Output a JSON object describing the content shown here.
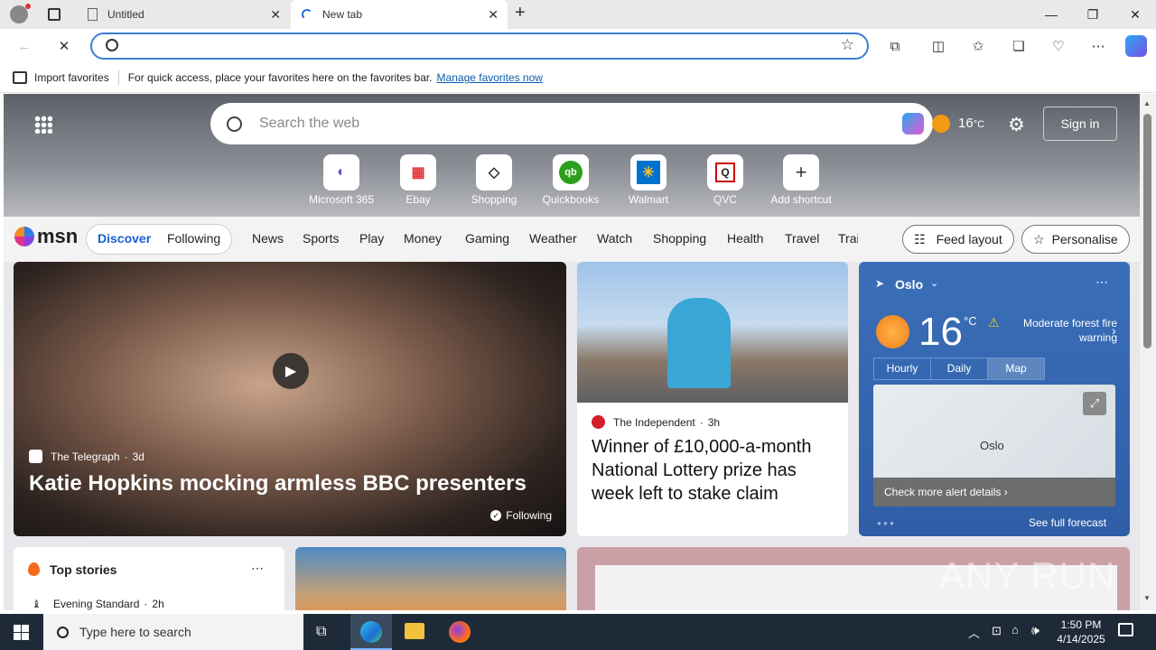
{
  "browser": {
    "tabs": [
      {
        "title": "Untitled"
      },
      {
        "title": "New tab"
      }
    ],
    "minimize": "—",
    "restore": "❐",
    "close": "✕",
    "add_tab": "+"
  },
  "favbar": {
    "import_label": "Import favorites",
    "hint": "For quick access, place your favorites here on the favorites bar.",
    "manage_link": "Manage favorites now"
  },
  "msn": {
    "search_placeholder": "Search the web",
    "temp": "16",
    "temp_unit": "°C",
    "sign_in": "Sign in",
    "shortcuts": [
      {
        "label": "Microsoft 365",
        "glyph": "◐"
      },
      {
        "label": "Ebay",
        "glyph": "▦"
      },
      {
        "label": "Shopping",
        "glyph": "◇"
      },
      {
        "label": "Quickbooks",
        "glyph": "qb"
      },
      {
        "label": "Walmart",
        "glyph": "✳"
      },
      {
        "label": "QVC",
        "glyph": "Q"
      },
      {
        "label": "Add shortcut",
        "glyph": "+"
      }
    ],
    "logo": "msn",
    "tabs": {
      "discover": "Discover",
      "following": "Following"
    },
    "nav": [
      "News",
      "Sports",
      "Play",
      "Money",
      "Gaming",
      "Weather",
      "Watch",
      "Shopping",
      "Health",
      "Travel",
      "Trai"
    ],
    "feed_layout": "Feed layout",
    "personalise": "Personalise"
  },
  "cards": {
    "main": {
      "source": "The Telegraph",
      "age": "3d",
      "title": "Katie Hopkins mocking armless BBC presenters",
      "following": "Following"
    },
    "second": {
      "source": "The Independent",
      "age": "3h",
      "title": "Winner of £10,000-a-month National Lottery prize has week left to stake claim"
    },
    "weather": {
      "city": "Oslo",
      "temp": "16",
      "unit": "°C",
      "alert": "Moderate forest fire warning",
      "tabs": [
        "Hourly",
        "Daily",
        "Map"
      ],
      "alert_link": "Check more alert details",
      "forecast": "See full forecast",
      "map_label": "Oslo"
    },
    "top_stories": {
      "title": "Top stories",
      "first_source": "Evening Standard",
      "first_age": "2h"
    }
  },
  "taskbar": {
    "search_placeholder": "Type here to search",
    "time": "1:50 PM",
    "date": "4/14/2025"
  },
  "watermark": "ANY RUN"
}
